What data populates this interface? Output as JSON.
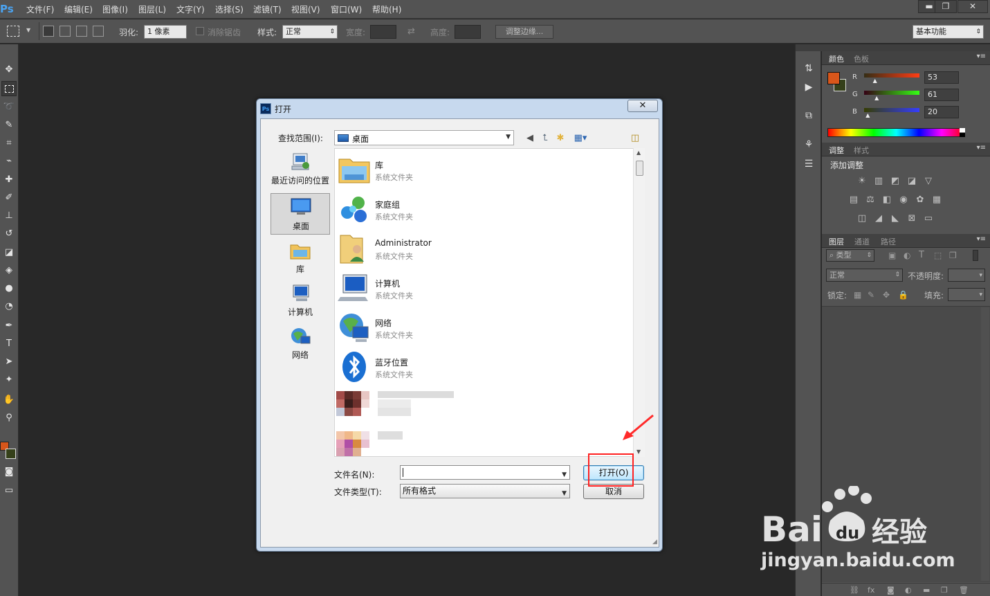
{
  "app": {
    "logo": "Ps"
  },
  "menu": {
    "items": [
      "文件(F)",
      "编辑(E)",
      "图像(I)",
      "图层(L)",
      "文字(Y)",
      "选择(S)",
      "滤镜(T)",
      "视图(V)",
      "窗口(W)",
      "帮助(H)"
    ]
  },
  "window_controls": {
    "minimize": "▬",
    "restore": "❐",
    "close": "✕"
  },
  "options_bar": {
    "feather_label": "羽化:",
    "feather_value": "1 像素",
    "antialias_label": "消除锯齿",
    "style_label": "样式:",
    "style_value": "正常",
    "width_label": "宽度:",
    "height_label": "高度:",
    "refine_edge_label": "调整边缘...",
    "workspace_value": "基本功能"
  },
  "color_panel": {
    "tabs": [
      "颜色",
      "色板"
    ],
    "foreground": "#d8561a",
    "background": "#35401a",
    "channels": [
      {
        "label": "R",
        "value": "53",
        "fraction": 0.208
      },
      {
        "label": "G",
        "value": "61",
        "fraction": 0.239
      },
      {
        "label": "B",
        "value": "20",
        "fraction": 0.078
      }
    ]
  },
  "adjustments_panel": {
    "tabs": [
      "调整",
      "样式"
    ],
    "title": "添加调整"
  },
  "layers_panel": {
    "tabs": [
      "图层",
      "通道",
      "路径"
    ],
    "filter_label": "类型",
    "blend_mode": "正常",
    "opacity_label": "不透明度:",
    "lock_label": "锁定:",
    "fill_label": "填充:"
  },
  "dialog": {
    "title": "打开",
    "close": "✕",
    "look_in_label": "查找范围(I):",
    "look_in_value": "桌面",
    "places": [
      {
        "label": "最近访问的位置",
        "icon": "recent-places-icon"
      },
      {
        "label": "桌面",
        "icon": "desktop-icon",
        "selected": true
      },
      {
        "label": "库",
        "icon": "libraries-icon"
      },
      {
        "label": "计算机",
        "icon": "computer-icon"
      },
      {
        "label": "网络",
        "icon": "network-icon"
      }
    ],
    "files": [
      {
        "name": "库",
        "type": "系统文件夹",
        "icon": "libraries-folder-icon"
      },
      {
        "name": "家庭组",
        "type": "系统文件夹",
        "icon": "homegroup-icon"
      },
      {
        "name": "Administrator",
        "type": "系统文件夹",
        "icon": "user-folder-icon"
      },
      {
        "name": "计算机",
        "type": "系统文件夹",
        "icon": "computer-icon"
      },
      {
        "name": "网络",
        "type": "系统文件夹",
        "icon": "network-icon"
      },
      {
        "name": "蓝牙位置",
        "type": "系统文件夹",
        "icon": "bluetooth-icon"
      }
    ],
    "file_name_label": "文件名(N):",
    "file_name_value": "",
    "file_type_label": "文件类型(T):",
    "file_type_value": "所有格式",
    "open_button": "打开(O)",
    "cancel_button": "取消"
  },
  "watermark": {
    "text": "jingyan.baidu.com",
    "logo_text": "Bai 经验"
  }
}
